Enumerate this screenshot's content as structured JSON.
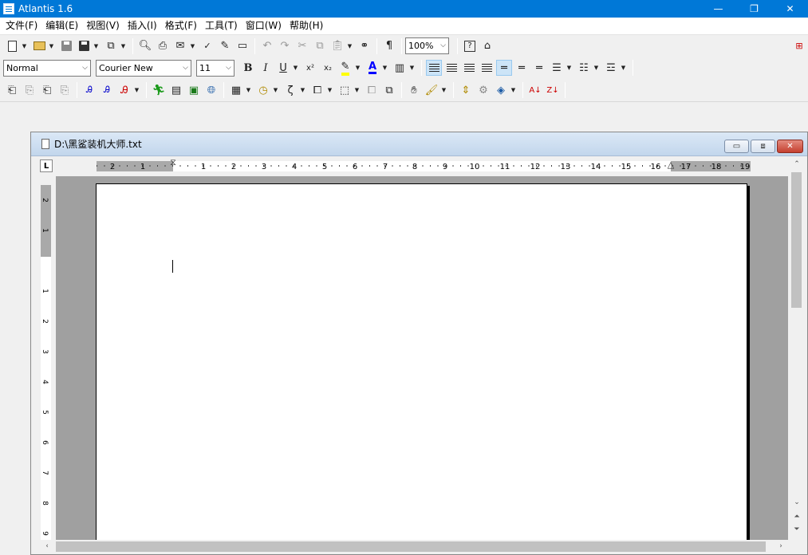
{
  "app": {
    "title": "Atlantis 1.6"
  },
  "window_buttons": {
    "minimize": "—",
    "maximize": "❐",
    "close": "✕"
  },
  "menu": [
    "文件(F)",
    "编辑(E)",
    "视图(V)",
    "插入(I)",
    "格式(F)",
    "工具(T)",
    "窗口(W)",
    "帮助(H)"
  ],
  "toolbar_standard": {
    "zoom": "100%",
    "pilcrow": "¶"
  },
  "toolbar_format": {
    "style": "Normal",
    "font": "Courier New",
    "size": "11",
    "bold": "B",
    "italic": "I",
    "underline": "U",
    "superscript": "x²",
    "subscript": "x₂",
    "highlight_color": "#ffff00",
    "font_color_letter": "A",
    "font_color": "#0000ff"
  },
  "document": {
    "title": "D:\\黑鲨装机大师.txt"
  },
  "ruler": {
    "corner": "L",
    "h_ticks": [
      "2",
      "1",
      "1",
      "2",
      "3",
      "4",
      "5",
      "6",
      "7",
      "8",
      "9",
      "10",
      "11",
      "12",
      "13",
      "14",
      "15",
      "16",
      "17",
      "18",
      "19"
    ],
    "v_ticks": [
      "2",
      "1",
      "1",
      "2",
      "3",
      "4",
      "5",
      "6",
      "7",
      "8",
      "9"
    ]
  },
  "colors": {
    "titlebar": "#0078d7",
    "workspace": "#ababab",
    "page": "#ffffff"
  }
}
